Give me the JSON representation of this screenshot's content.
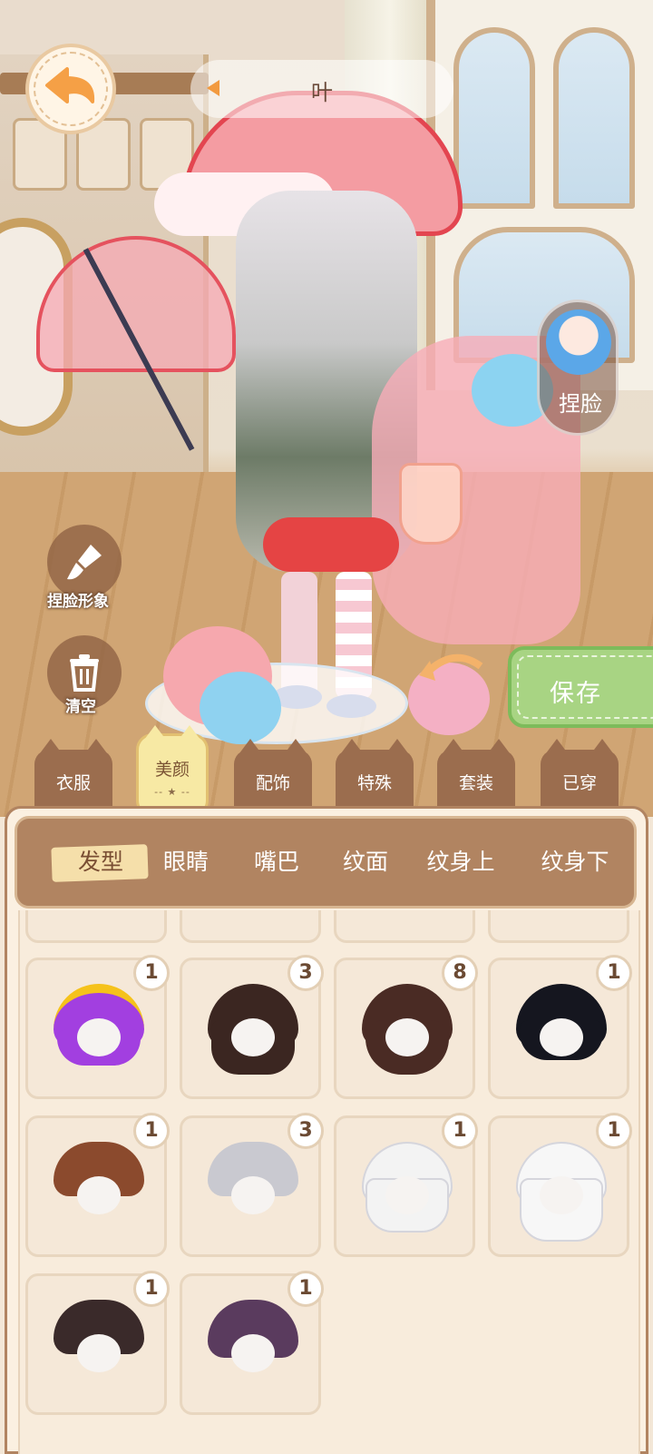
{
  "top_bar": {
    "chip_text": "叶"
  },
  "right_buttons": {
    "face_label": "捏脸"
  },
  "left_tools": {
    "face_image_label": "捏脸形象",
    "clear_label": "清空"
  },
  "save": {
    "label": "保存"
  },
  "categories": [
    {
      "label": "衣服"
    },
    {
      "label": "美颜",
      "sub": "-- ★ --"
    },
    {
      "label": "配饰"
    },
    {
      "label": "特殊"
    },
    {
      "label": "套装"
    },
    {
      "label": "已穿"
    }
  ],
  "active_category": "美颜",
  "sub_tabs": [
    "发型",
    "眼睛",
    "嘴巴",
    "纹面",
    "纹身上",
    "纹身下"
  ],
  "active_sub_tab": "发型",
  "items": [
    {
      "count": "1",
      "hair_color": "#a23fe0",
      "accent": "#f5c21b",
      "style": "spiky"
    },
    {
      "count": "3",
      "hair_color": "#3b2621",
      "style": "long"
    },
    {
      "count": "8",
      "hair_color": "#4a2b24",
      "style": "wavy"
    },
    {
      "count": "1",
      "hair_color": "#15161f",
      "style": "bob"
    },
    {
      "count": "1",
      "hair_color": "#8b4a2d",
      "style": "short"
    },
    {
      "count": "3",
      "hair_color": "#c9c9d0",
      "style": "short"
    },
    {
      "count": "1",
      "hair_color": "#f3f3f3",
      "style": "long"
    },
    {
      "count": "1",
      "hair_color": "#f7f7f7",
      "style": "braid"
    },
    {
      "count": "1",
      "hair_color": "#3a2a2a",
      "style": "short"
    },
    {
      "count": "1",
      "hair_color": "#5a3b5e",
      "style": "short"
    }
  ],
  "colors": {
    "panel_brown": "#b18461",
    "tab_brown": "#9b6d4e",
    "active_tab": "#f7e9a4",
    "save_green": "#a8d483",
    "panel_bg": "#fbf0e1"
  }
}
